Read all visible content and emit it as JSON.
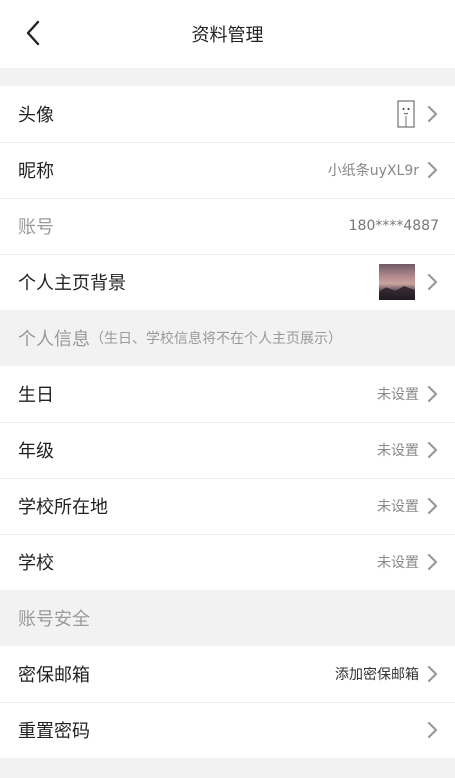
{
  "header": {
    "title": "资料管理"
  },
  "profile": {
    "avatar_label": "头像",
    "nickname_label": "昵称",
    "nickname_value": "小纸条uyXL9r",
    "account_label": "账号",
    "account_value": "180****4887",
    "homepage_bg_label": "个人主页背景"
  },
  "personal_info": {
    "section_title": "个人信息",
    "section_note": "（生日、学校信息将不在个人主页展示）",
    "rows": [
      {
        "label": "生日",
        "value": "未设置"
      },
      {
        "label": "年级",
        "value": "未设置"
      },
      {
        "label": "学校所在地",
        "value": "未设置"
      },
      {
        "label": "学校",
        "value": "未设置"
      }
    ]
  },
  "security": {
    "section_title": "账号安全",
    "email_label": "密保邮箱",
    "email_value": "添加密保邮箱",
    "reset_password_label": "重置密码"
  },
  "icons": {
    "back": "chevron-left-icon",
    "row_arrow": "chevron-right-icon",
    "avatar": "avatar-placeholder-icon"
  },
  "colors": {
    "background": "#f2f2f2",
    "row_bg": "#ffffff",
    "chevron": "#9a9a9a"
  }
}
